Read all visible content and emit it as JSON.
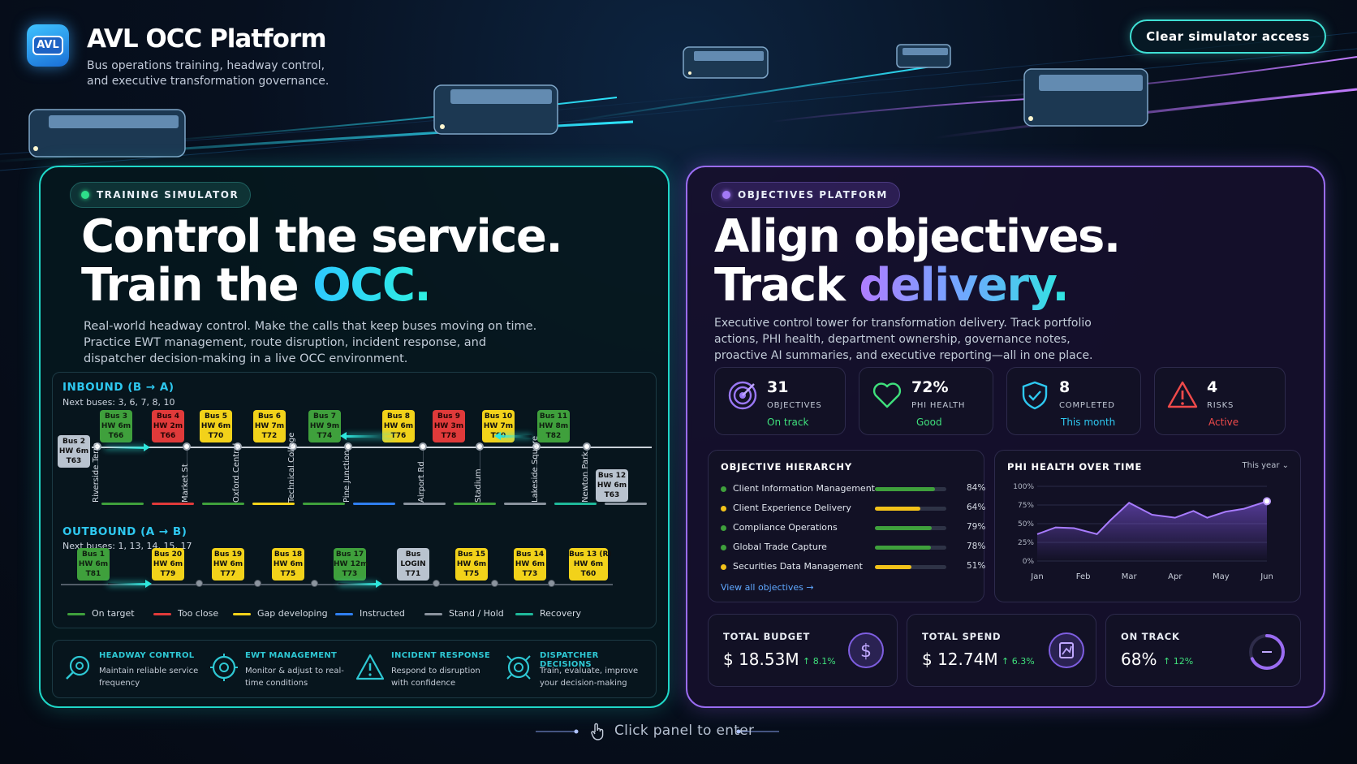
{
  "header": {
    "logo_text": "AVL",
    "title": "AVL OCC Platform",
    "subtitle": "Bus operations training, headway control, and executive transformation governance.",
    "clear_button": "Clear simulator access"
  },
  "simulator": {
    "pill": "TRAINING SIMULATOR",
    "headline_1": "Control the service.",
    "headline_2a": "Train the ",
    "headline_2b": "OCC.",
    "description": "Real-world headway control. Make the calls that keep buses moving on time. Practice EWT management, route disruption, incident response, and dispatcher decision-making in a live OCC environment.",
    "inbound": {
      "title": "INBOUND (B → A)",
      "next": "Next buses: 3, 6, 7, 8, 10",
      "buses": [
        {
          "label": "Bus 3\nHW 6m\nT66",
          "status": "g"
        },
        {
          "label": "Bus 4\nHW 2m\nT66",
          "status": "r"
        },
        {
          "label": "Bus 5\nHW 6m\nT70",
          "status": "y"
        },
        {
          "label": "Bus 6\nHW 7m\nT72",
          "status": "y"
        },
        {
          "label": "Bus 7\nHW 9m\nT74",
          "status": "g"
        },
        {
          "label": "Bus 8\nHW 6m\nT76",
          "status": "y"
        },
        {
          "label": "Bus 9\nHW 3m\nT78",
          "status": "r"
        },
        {
          "label": "Bus 10\nHW 7m\nT80",
          "status": "y"
        },
        {
          "label": "Bus 11\nHW 8m\nT82",
          "status": "g"
        }
      ],
      "end_bus_left": "Bus 2\nHW 6m\nT63",
      "end_bus_right": "Bus 12\nHW 6m\nT63",
      "stops": [
        "Riverside Term",
        "Market St",
        "Oxford Central",
        "Technical College",
        "Pine Junction",
        "Airport Rd",
        "Stadium",
        "Lakeside Square",
        "Newton Park"
      ]
    },
    "outbound": {
      "title": "OUTBOUND (A → B)",
      "next": "Next buses: 1, 13, 14, 15, 17",
      "buses": [
        {
          "label": "Bus 1\nHW 6m\nT81",
          "status": "g"
        },
        {
          "label": "Bus 20\nHW 6m\nT79",
          "status": "y"
        },
        {
          "label": "Bus 19\nHW 6m\nT77",
          "status": "y"
        },
        {
          "label": "Bus 18\nHW 6m\nT75",
          "status": "y"
        },
        {
          "label": "Bus 17\nHW 12m\nT73",
          "status": "g"
        },
        {
          "label": "Bus\nLOGIN\nT71",
          "status": "s"
        },
        {
          "label": "Bus 15\nHW 6m\nT75",
          "status": "y"
        },
        {
          "label": "Bus 14\nHW 6m\nT73",
          "status": "y"
        },
        {
          "label": "Bus 13 (R)\nHW 6m\nT60",
          "status": "y"
        }
      ]
    },
    "legend": [
      {
        "label": "On target",
        "color": "#3fa03c"
      },
      {
        "label": "Too close",
        "color": "#e03a3a"
      },
      {
        "label": "Gap developing",
        "color": "#f2d21a"
      },
      {
        "label": "Instructed",
        "color": "#2f7ff0"
      },
      {
        "label": "Stand / Hold",
        "color": "#8a939e"
      },
      {
        "label": "Recovery",
        "color": "#1fb89a"
      }
    ],
    "features": [
      {
        "title": "HEADWAY CONTROL",
        "desc": "Maintain reliable service frequency",
        "icon": "headway-icon"
      },
      {
        "title": "EWT MANAGEMENT",
        "desc": "Monitor & adjust to real-time conditions",
        "icon": "ewt-icon"
      },
      {
        "title": "INCIDENT RESPONSE",
        "desc": "Respond to disruption with confidence",
        "icon": "warning-icon"
      },
      {
        "title": "DISPATCHER DECISIONS",
        "desc": "Train, evaluate, improve your decision-making",
        "icon": "dispatch-icon"
      }
    ]
  },
  "objectives": {
    "pill": "OBJECTIVES PLATFORM",
    "headline_1": "Align objectives.",
    "headline_2a": "Track ",
    "headline_2b": "delivery.",
    "description": "Executive control tower for transformation delivery. Track portfolio actions, PHI health, department ownership, governance notes, proactive AI summaries, and executive reporting—all in one place.",
    "stats": [
      {
        "value": "31",
        "label": "OBJECTIVES",
        "sub": "On track",
        "sub_color": "#3fe07c",
        "icon": "target-icon"
      },
      {
        "value": "72%",
        "label": "PHI HEALTH",
        "sub": "Good",
        "sub_color": "#3fe07c",
        "icon": "heart-icon"
      },
      {
        "value": "8",
        "label": "COMPLETED",
        "sub": "This month",
        "sub_color": "#2ec8f0",
        "icon": "shield-check-icon"
      },
      {
        "value": "4",
        "label": "RISKS",
        "sub": "Active",
        "sub_color": "#f04a4a",
        "icon": "alert-icon"
      }
    ],
    "hierarchy": {
      "title": "OBJECTIVE HIERARCHY",
      "rows": [
        {
          "name": "Client Information Management",
          "pct": "84%",
          "value": 0.84,
          "color": "#3fa03c"
        },
        {
          "name": "Client Experience Delivery",
          "pct": "64%",
          "value": 0.64,
          "color": "#f2c21a"
        },
        {
          "name": "Compliance Operations",
          "pct": "79%",
          "value": 0.79,
          "color": "#3fa03c"
        },
        {
          "name": "Global Trade Capture",
          "pct": "78%",
          "value": 0.78,
          "color": "#3fa03c"
        },
        {
          "name": "Securities Data Management",
          "pct": "51%",
          "value": 0.51,
          "color": "#f2c21a"
        }
      ],
      "view_all": "View all objectives →"
    },
    "phi_chart": {
      "title": "PHI HEALTH OVER TIME",
      "period": "This year ⌄",
      "chart_data": {
        "type": "area",
        "x": [
          "Jan",
          "Feb",
          "Mar",
          "Apr",
          "May",
          "Jun"
        ],
        "y_ticks": [
          "100%",
          "75%",
          "50%",
          "25%",
          "0%"
        ],
        "ylim": [
          0,
          100
        ],
        "series": [
          {
            "x": [
              0,
              0.4,
              0.8,
              1.3,
              1.6,
              2.0,
              2.5,
              3.0,
              3.4,
              3.7,
              4.1,
              4.5,
              5.0
            ],
            "values": [
              36,
              45,
              44,
              36,
              55,
              78,
              62,
              58,
              67,
              58,
              66,
              70,
              80
            ]
          }
        ]
      }
    },
    "money": [
      {
        "label": "TOTAL BUDGET",
        "value": "$ 18.53M",
        "change": "↑ 8.1%",
        "icon": "dollar-icon"
      },
      {
        "label": "TOTAL SPEND",
        "value": "$ 12.74M",
        "change": "↑ 6.3%",
        "icon": "spend-icon"
      },
      {
        "label": "ON TRACK",
        "value": "68%",
        "change": "↑ 12%",
        "icon": "progress-ring-icon",
        "ring_value": 0.68
      }
    ]
  },
  "footer": {
    "hint": "Click panel to enter"
  }
}
